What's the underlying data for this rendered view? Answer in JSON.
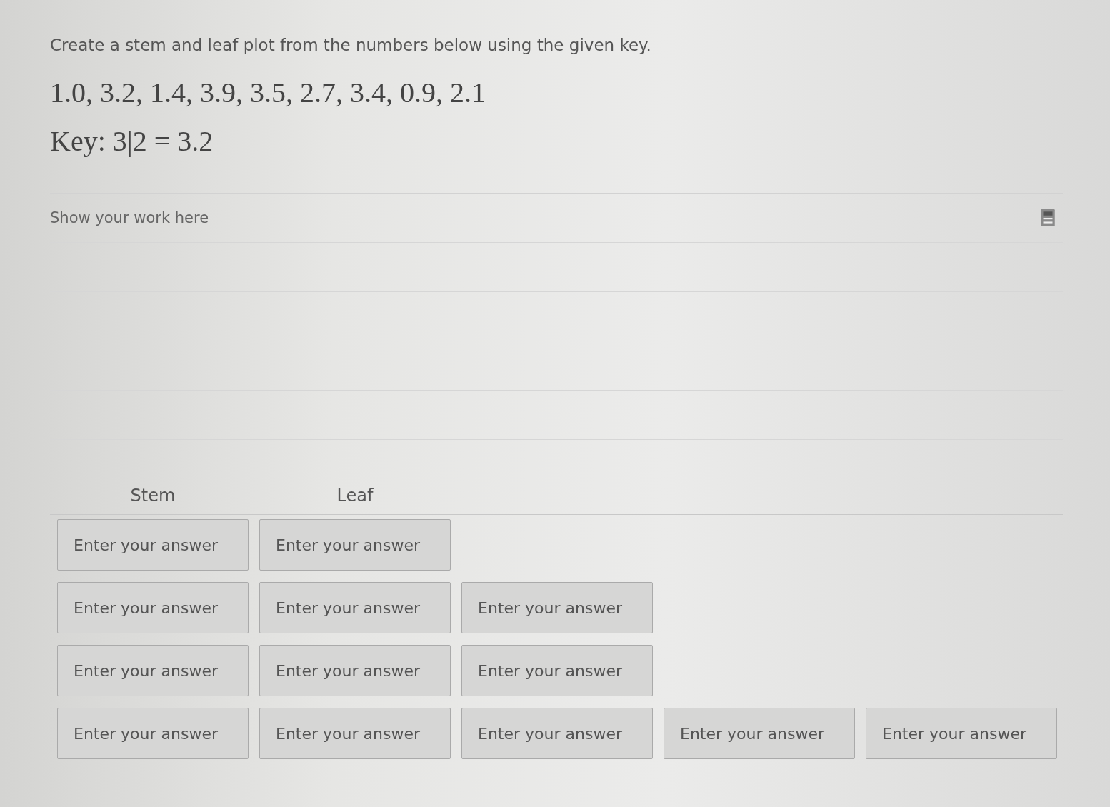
{
  "question": "Create a stem and leaf plot from the numbers below using the given key.",
  "numbers": "1.0, 3.2, 1.4, 3.9, 3.5, 2.7, 3.4, 0.9, 2.1",
  "key": "Key: 3|2 = 3.2",
  "work_area": {
    "label": "Show your work here"
  },
  "plot": {
    "headers": [
      "Stem",
      "Leaf"
    ],
    "rows": [
      {
        "stem": {
          "placeholder": "Enter your answer"
        },
        "leaves": [
          {
            "placeholder": "Enter your answer"
          }
        ]
      },
      {
        "stem": {
          "placeholder": "Enter your answer"
        },
        "leaves": [
          {
            "placeholder": "Enter your answer"
          },
          {
            "placeholder": "Enter your answer"
          }
        ]
      },
      {
        "stem": {
          "placeholder": "Enter your answer"
        },
        "leaves": [
          {
            "placeholder": "Enter your answer"
          },
          {
            "placeholder": "Enter your answer"
          }
        ]
      },
      {
        "stem": {
          "placeholder": "Enter your answer"
        },
        "leaves": [
          {
            "placeholder": "Enter your answer"
          },
          {
            "placeholder": "Enter your answer"
          },
          {
            "placeholder": "Enter your answer"
          },
          {
            "placeholder": "Enter your answer"
          }
        ]
      }
    ]
  }
}
